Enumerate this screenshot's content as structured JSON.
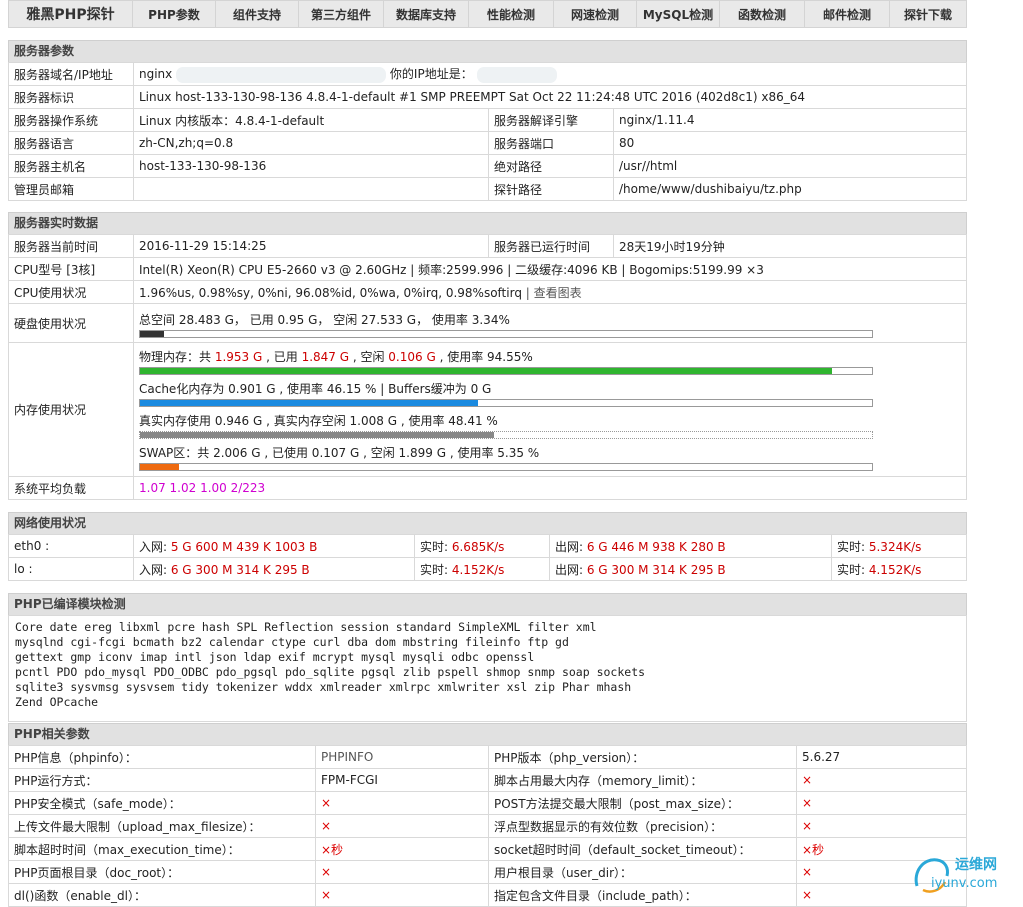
{
  "nav": {
    "brand": "雅黑PHP探针",
    "items": [
      "PHP参数",
      "组件支持",
      "第三方组件",
      "数据库支持",
      "性能检测",
      "网速检测",
      "MySQL检测",
      "函数检测",
      "邮件检测",
      "探针下载"
    ]
  },
  "server_params": {
    "title": "服务器参数",
    "domain_label": "服务器域名/IP地址",
    "domain_value": "nginx",
    "your_ip_label": "你的IP地址是：",
    "ident_label": "服务器标识",
    "ident_value": "Linux host-133-130-98-136 4.8.4-1-default #1 SMP PREEMPT Sat Oct 22 11:24:48 UTC 2016 (402d8c1) x86_64",
    "os_label": "服务器操作系统",
    "os_value": "Linux  内核版本：4.8.4-1-default",
    "engine_label": "服务器解译引擎",
    "engine_value": "nginx/1.11.4",
    "lang_label": "服务器语言",
    "lang_value": "zh-CN,zh;q=0.8",
    "port_label": "服务器端口",
    "port_value": "80",
    "host_label": "服务器主机名",
    "host_value": "host-133-130-98-136",
    "abs_label": "绝对路径",
    "abs_value": "/usr//html",
    "admin_label": "管理员邮箱",
    "admin_value": "",
    "probe_label": "探针路径",
    "probe_value": "/home/www/dushibaiyu/tz.php"
  },
  "realtime": {
    "title": "服务器实时数据",
    "time_label": "服务器当前时间",
    "time_value": "2016-11-29 15:14:25",
    "uptime_label": "服务器已运行时间",
    "uptime_value": "28天19小时19分钟",
    "cpu_label": "CPU型号 [3核]",
    "cpu_value": "Intel(R) Xeon(R) CPU E5-2660 v3 @ 2.60GHz | 频率:2599.996 | 二级缓存:4096 KB | Bogomips:5199.99 ×3",
    "cpuuse_label": "CPU使用状况",
    "cpuuse_value": "1.96%us, 0.98%sy, 0%ni, 96.08%id, 0%wa, 0%irq, 0.98%softirq",
    "cpuuse_link": "查看图表",
    "disk_label": "硬盘使用状况",
    "disk_text": "总空间 28.483 G，  已用 0.95 G，  空闲 27.533 G，  使用率 3.34%",
    "disk_pct": 3.34,
    "mem_label": "内存使用状况",
    "mem_phys_a": "物理内存：共 ",
    "mem_phys_total": "1.953 G",
    "mem_phys_b": " , 已用 ",
    "mem_phys_used": "1.847 G",
    "mem_phys_c": " , 空闲 ",
    "mem_phys_free": "0.106 G",
    "mem_phys_d": " , 使用率 94.55%",
    "mem_phys_pct": 94.55,
    "mem_cache": "Cache化内存为 0.901 G , 使用率 46.15 % | Buffers缓冲为 0 G",
    "mem_cache_pct": 46.15,
    "mem_real": "真实内存使用 0.946 G , 真实内存空闲 1.008 G , 使用率 48.41 %",
    "mem_real_pct": 48.41,
    "mem_swap": "SWAP区：共 2.006 G , 已使用 0.107 G , 空闲 1.899 G , 使用率 5.35 %",
    "mem_swap_pct": 5.35,
    "load_label": "系统平均负载",
    "load_value": "1.07 1.02 1.00 2/223"
  },
  "network": {
    "title": "网络使用状况",
    "rows": [
      {
        "iface": "eth0 :",
        "in_label": "入网: ",
        "in_value": "5 G 600 M 439 K 1003 B",
        "rt1_label": "实时: ",
        "rt1_value": "6.685K/s",
        "out_label": "出网: ",
        "out_value": "6 G 446 M 938 K 280 B",
        "rt2_label": "实时: ",
        "rt2_value": "5.324K/s"
      },
      {
        "iface": "lo :",
        "in_label": "入网: ",
        "in_value": "6 G 300 M 314 K 295 B",
        "rt1_label": "实时: ",
        "rt1_value": "4.152K/s",
        "out_label": "出网: ",
        "out_value": "6 G 300 M 314 K 295 B",
        "rt2_label": "实时: ",
        "rt2_value": "4.152K/s"
      }
    ]
  },
  "modules": {
    "title": "PHP已编译模块检测",
    "lines": [
      "Core  date  ereg  libxml  pcre  hash  SPL  Reflection  session  standard  SimpleXML  filter  xml",
      "mysqlnd  cgi-fcgi  bcmath  bz2  calendar  ctype  curl  dba  dom  mbstring  fileinfo  ftp  gd",
      "gettext  gmp  iconv  imap  intl  json  ldap  exif  mcrypt  mysql  mysqli  odbc  openssl",
      "pcntl  PDO  pdo_mysql  PDO_ODBC  pdo_pgsql  pdo_sqlite  pgsql  zlib  pspell  shmop  snmp  soap  sockets",
      "sqlite3  sysvmsg  sysvsem  tidy  tokenizer  wddx  xmlreader  xmlrpc  xmlwriter  xsl  zip  Phar  mhash",
      "Zend OPcache"
    ]
  },
  "php_params": {
    "title": "PHP相关参数",
    "rows": [
      {
        "l1": "PHP信息（phpinfo）：",
        "v1": "PHPINFO",
        "l2": "PHP版本（php_version）：",
        "v2": "5.6.27"
      },
      {
        "l1": "PHP运行方式：",
        "v1": "FPM-FCGI",
        "l2": "脚本占用最大内存（memory_limit）：",
        "v2": "×"
      },
      {
        "l1": "PHP安全模式（safe_mode）：",
        "v1": "×",
        "l2": "POST方法提交最大限制（post_max_size）：",
        "v2": "×"
      },
      {
        "l1": "上传文件最大限制（upload_max_filesize）：",
        "v1": "×",
        "l2": "浮点型数据显示的有效位数（precision）：",
        "v2": "×"
      },
      {
        "l1": "脚本超时时间（max_execution_time）：",
        "v1": "×秒",
        "l2": "socket超时时间（default_socket_timeout）：",
        "v2": "×秒"
      },
      {
        "l1": "PHP页面根目录（doc_root）：",
        "v1": "×",
        "l2": "用户根目录（user_dir）：",
        "v2": "×"
      },
      {
        "l1": "dl()函数（enable_dl）：",
        "v1": "×",
        "l2": "指定包含文件目录（include_path）：",
        "v2": "×"
      }
    ]
  },
  "watermark": {
    "line1": "运维网",
    "line2": "iyunv.com"
  },
  "colors": {
    "disk_bar": "#333333",
    "phys_bar": "#2fb52f",
    "cache_bar": "#1a8ae0",
    "real_bar": "#888888",
    "swap_bar": "#ee6a10",
    "red": "#cc0000",
    "load": "#d000d0"
  }
}
